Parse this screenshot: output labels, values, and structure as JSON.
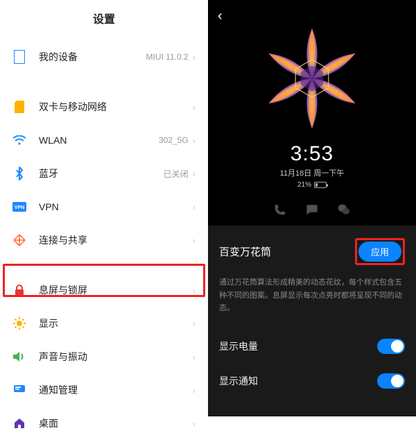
{
  "left": {
    "title": "设置",
    "items": [
      {
        "label": "我的设备",
        "value": "MIUI 11.0.2",
        "icon": "device"
      },
      null,
      {
        "label": "双卡与移动网络",
        "value": "",
        "icon": "sim"
      },
      {
        "label": "WLAN",
        "value": "302_5G",
        "icon": "wifi"
      },
      {
        "label": "蓝牙",
        "value": "已关闭",
        "icon": "bluetooth"
      },
      {
        "label": "VPN",
        "value": "",
        "icon": "vpn"
      },
      {
        "label": "连接与共享",
        "value": "",
        "icon": "share"
      },
      null,
      {
        "label": "息屏与锁屏",
        "value": "",
        "icon": "lock",
        "highlight": true
      },
      {
        "label": "显示",
        "value": "",
        "icon": "display"
      },
      {
        "label": "声音与振动",
        "value": "",
        "icon": "sound"
      },
      {
        "label": "通知管理",
        "value": "",
        "icon": "notify"
      },
      {
        "label": "桌面",
        "value": "",
        "icon": "home"
      }
    ]
  },
  "right": {
    "clock": {
      "time": "3:53",
      "date": "11月18日 周一下午",
      "battery_pct": "21%"
    },
    "panel": {
      "title": "百变万花筒",
      "apply_label": "应用",
      "description": "通过万花筒算法形成精美的动态花纹，每个样式包含五种不同的图案。息屏显示每次点亮时都将呈现不同的动态。",
      "rows": [
        {
          "label": "显示电量",
          "on": true
        },
        {
          "label": "显示通知",
          "on": true
        }
      ]
    }
  },
  "colors": {
    "accent": "#0a84ff",
    "highlight": "#e22"
  }
}
